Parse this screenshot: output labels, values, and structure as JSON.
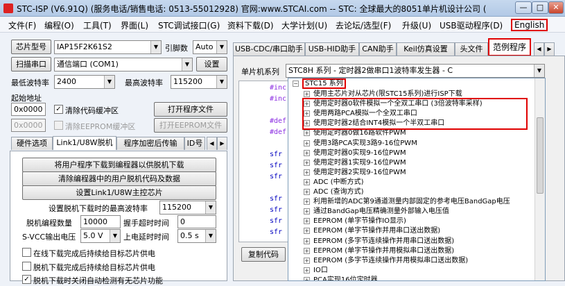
{
  "window": {
    "title": "STC-ISP (V6.91Q) (服务电话/销售电话: 0513-55012928) 官网:www.STCAI.com  -- STC: 全球最大的8051单片机设计公司 (",
    "min": "—",
    "max": "□",
    "close": "✕"
  },
  "menu": [
    "文件(F)",
    "编程(O)",
    "工具(T)",
    "界面(L)",
    "STC调试接口(G)",
    "资料下载(D)",
    "大学计划(U)",
    "去论坛/选型(F)",
    "升级(U)",
    "USB驱动程序(D)",
    "English"
  ],
  "left": {
    "chip_model_btn": "芯片型号",
    "chip_model_value": "IAP15F2K61S2",
    "pin_count_label": "引脚数",
    "pin_count_value": "Auto",
    "scan_port_btn": "扫描串口",
    "port_value": "通信端口 (COM1)",
    "settings_btn": "设置",
    "min_baud_label": "最低波特率",
    "min_baud_value": "2400",
    "max_baud_label": "最高波特率",
    "max_baud_value": "115200",
    "start_addr_label": "起始地址",
    "code_addr": "0x0000",
    "clear_code_label": "清除代码缓冲区",
    "open_prog_btn": "打开程序文件",
    "eeprom_addr": "0x0000",
    "clear_eeprom_label": "清除EEPROM缓冲区",
    "open_eeprom_btn": "打开EEPROM文件",
    "tabs": [
      "硬件选项",
      "Link1/U8W脱机",
      "程序加密后传输",
      "ID号"
    ],
    "offline": {
      "btn_download_to_programmer": "将用户程序下载到编程器以供脱机下载",
      "btn_clear_programmer": "清除编程器中的用户脱机代码及数据",
      "btn_set_link1": "设置Link1/U8W主控芯片",
      "max_baud_label": "设置脱机下载时的最高波特率",
      "max_baud_value": "115200",
      "count_label": "脱机编程数量",
      "count_value": "10000",
      "handshake_label": "握手超时时间",
      "handshake_value": "0",
      "svcc_label": "S-VCC输出电压",
      "svcc_value": "5.0 V",
      "poweron_label": "上电延时时间",
      "poweron_value": "0.5 s",
      "chk1": "在线下载完成后持续给目标芯片供电",
      "chk2": "脱机下载完成后持续给目标芯片供电",
      "chk3": "脱机下载时关闭自动检测有无芯片功能"
    }
  },
  "right": {
    "tabs": [
      "USB-CDC/串口助手",
      "USB-HID助手",
      "CAN助手",
      "Keil仿真设置",
      "头文件",
      "范例程序"
    ],
    "active_tab": "范例程序",
    "mcu_series_label": "单片机系列",
    "mcu_series_value": "STC8H 系列 - 定时器2做串口1波特率发生器 - C",
    "copy_code_btn": "复制代码",
    "code_lines": [
      "#inc",
      "#inc",
      "#def",
      "#def",
      "sfr",
      "sfr",
      "sfr",
      "sfr",
      "sfr",
      "sfr",
      "sfr"
    ],
    "tree_root": "STC15 系列",
    "tree_items": [
      "使用主芯片对从芯片(限STC15系列)进行ISP下载",
      "使用定时器0软件模拟一个全双工串口 (3倍波特率采样)",
      "使用两路PCA模拟一个全双工串口",
      "使用定时器2结合INT4模拟一个半双工串口",
      "使用定时器0做16路软件PWM",
      "使用3路PCA实现3路9-16位PWM",
      "使用定时器0实现9-16位PWM",
      "使用定时器1实现9-16位PWM",
      "使用定时器2实现9-16位PWM",
      "ADC (中断方式)",
      "ADC (查询方式)",
      "利用新增的ADC第9通道测量内部固定的参考电压BandGap电压",
      "通过BandGap电压精确测量外部输入电压值",
      "EEPROM (单字节操作IO显示)",
      "EEPROM (单字节操作并用串口送出数据)",
      "EEPROM (多字节连续操作并用串口送出数据)",
      "EEPROM (单字节操作并用模拟串口送出数据)",
      "EEPROM (多字节连续操作并用模拟串口送出数据)",
      "IO口",
      "PCA实现16位定时器"
    ]
  },
  "colors": {
    "annotation": "#e00000",
    "accent": "#d22222"
  }
}
